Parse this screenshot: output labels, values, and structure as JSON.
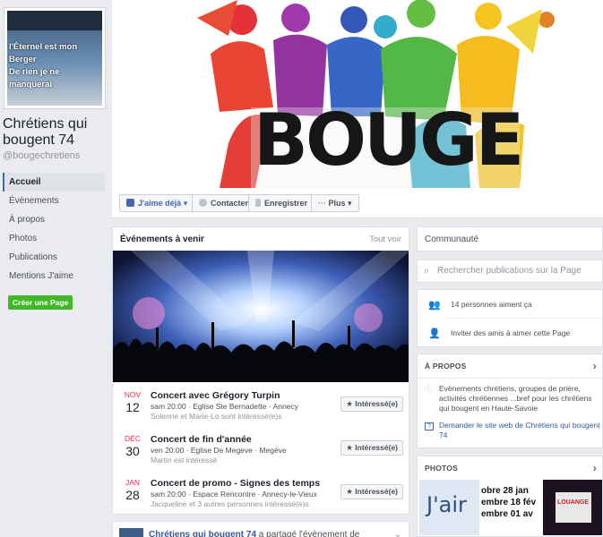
{
  "profile": {
    "verse_line1": "l'Éternel est mon Berger",
    "verse_line2": "De rien je ne manquerai",
    "name": "Chrétiens qui bougent 74",
    "handle": "@bougechretiens"
  },
  "nav": {
    "items": [
      "Accueil",
      "Évènements",
      "À propos",
      "Photos",
      "Publications",
      "Mentions J'aime"
    ],
    "create_page": "Créer une Page"
  },
  "cover": {
    "wordmark": "BOUGE"
  },
  "actions": {
    "like": "J'aime déjà",
    "contact": "Contacter",
    "save": "Enregistrer",
    "more": "Plus"
  },
  "events": {
    "title": "Événements à venir",
    "see_all": "Tout voir",
    "interested_label": "★ Intéressé(e)",
    "items": [
      {
        "month": "NOV",
        "day": "12",
        "title": "Concert avec Grégory Turpin",
        "meta": "sam 20:00 · Eglise Ste Bernadette · Annecy",
        "social": "Solenne et Marie-Lo sont intéressé(e)s"
      },
      {
        "month": "DÉC",
        "day": "30",
        "title": "Concert de fin d'année",
        "meta": "ven 20:00 · Eglise De Megeve · Megève",
        "social": "Martin est intéressé"
      },
      {
        "month": "JAN",
        "day": "28",
        "title": "Concert de promo - Signes des temps",
        "meta": "sam 20:00 · Espace Rencontre · Annecy-le-Vieux",
        "social": "Jacqueline et 3 autres personnes intéressé(e)s"
      }
    ]
  },
  "story": {
    "page": "Chrétiens qui bougent 74",
    "text": " a partagé l'évènement de"
  },
  "community": {
    "title": "Communauté",
    "search_placeholder": "Rechercher publications sur la Page",
    "likes": "14 personnes aiment ça",
    "invite": "Inviter des amis à aimer cette Page"
  },
  "about": {
    "title": "À PROPOS",
    "description": "Evènements chrétiens, groupes de prière, activités chrétiennes ...bref pour les chrétiens qui bougent en Haute-Savoie",
    "website_prompt": "Demander le site web de Chrétiens qui bougent 74"
  },
  "photos": {
    "title": "PHOTOS",
    "p1_text": "J'air",
    "p2_lines": [
      "obre",
      "28 jan",
      "embre",
      "18 fév",
      "embre",
      "01 av"
    ],
    "p3_text": "LOUANGE"
  },
  "colors": {
    "brand": "#4267b2",
    "accent_red": "#f02849",
    "green": "#42b72a"
  }
}
